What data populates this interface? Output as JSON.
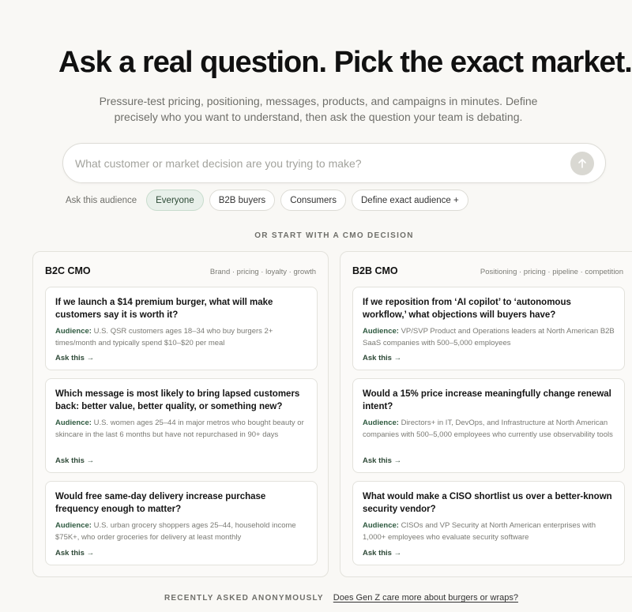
{
  "hero": {
    "title": "Ask a real question. Pick the exact market.",
    "subtitle": "Pressure-test pricing, positioning, messages, products, and campaigns in minutes. Define precisely who you want to understand, then ask the question your team is debating."
  },
  "search": {
    "placeholder": "What customer or market decision are you trying to make?",
    "value": "",
    "send_icon": "arrow-up-icon"
  },
  "audience": {
    "label": "Ask this audience",
    "chips": [
      "Everyone",
      "B2B buyers",
      "Consumers",
      "Define exact audience +"
    ],
    "selected": "Everyone"
  },
  "section_heading": "OR START WITH A CMO DECISION",
  "panels": [
    {
      "title": "B2C CMO",
      "tags": "Brand · pricing · loyalty · growth",
      "cards": [
        {
          "question": "If we launch a $14 premium burger, what will make customers say it is worth it?",
          "audience_label": "Audience:",
          "audience": "U.S. QSR customers ages 18–34 who buy burgers 2+ times/month and typically spend $10–$20 per meal",
          "cta": "Ask this →"
        },
        {
          "question": "Which message is most likely to bring lapsed customers back: better value, better quality, or something new?",
          "audience_label": "Audience:",
          "audience": "U.S. women ages 25–44 in major metros who bought beauty or skincare in the last 6 months but have not repurchased in 90+ days",
          "cta": "Ask this →"
        },
        {
          "question": "Would free same-day delivery increase purchase frequency enough to matter?",
          "audience_label": "Audience:",
          "audience": "U.S. urban grocery shoppers ages 25–44, household income $75K+, who order groceries for delivery at least monthly",
          "cta": "Ask this →"
        }
      ]
    },
    {
      "title": "B2B CMO",
      "tags": "Positioning · pricing · pipeline · competition",
      "cards": [
        {
          "question": "If we reposition from ‘AI copilot’ to ‘autonomous workflow,’ what objections will buyers have?",
          "audience_label": "Audience:",
          "audience": "VP/SVP Product and Operations leaders at North American B2B SaaS companies with 500–5,000 employees",
          "cta": "Ask this →"
        },
        {
          "question": "Would a 15% price increase meaningfully change renewal intent?",
          "audience_label": "Audience:",
          "audience": "Directors+ in IT, DevOps, and Infrastructure at North American companies with 500–5,000 employees who currently use observability tools",
          "cta": "Ask this →"
        },
        {
          "question": "What would make a CISO shortlist us over a better-known security vendor?",
          "audience_label": "Audience:",
          "audience": "CISOs and VP Security at North American enterprises with 1,000+ employees who evaluate security software",
          "cta": "Ask this →"
        }
      ]
    }
  ],
  "recent": {
    "label": "RECENTLY ASKED ANONYMOUSLY",
    "link": "Does Gen Z care more about burgers or wraps?"
  }
}
